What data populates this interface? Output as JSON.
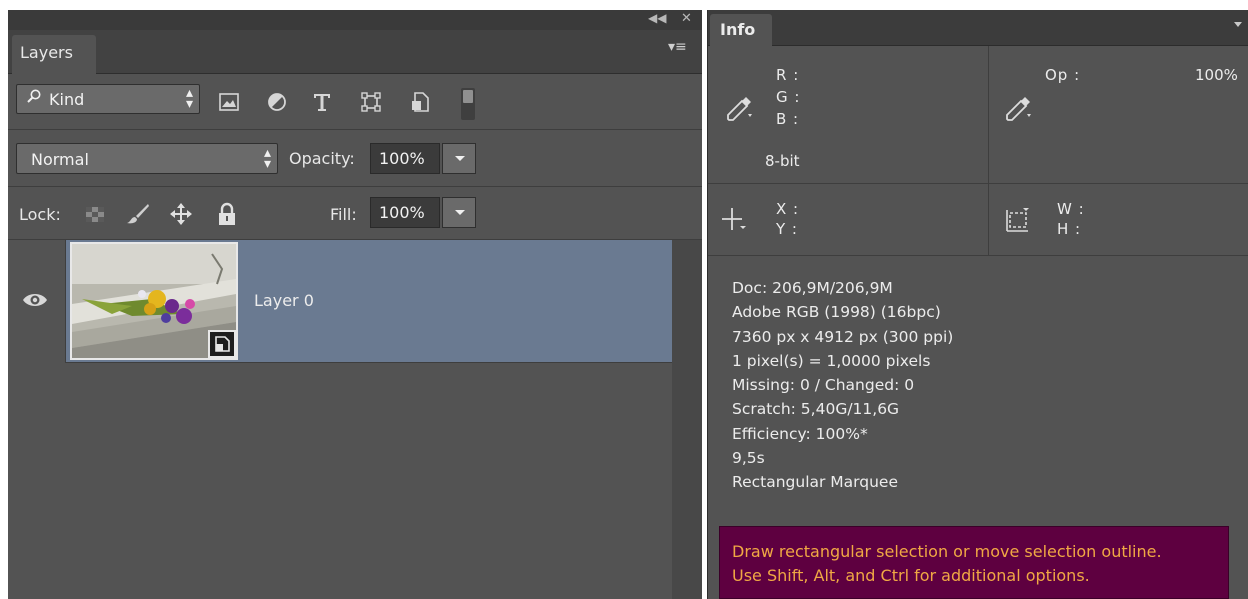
{
  "layers_panel": {
    "tab_label": "Layers",
    "filter": {
      "kind_label": "Kind"
    },
    "blend": {
      "mode": "Normal",
      "opacity_label": "Opacity:",
      "opacity_value": "100%"
    },
    "lock": {
      "label": "Lock:",
      "fill_label": "Fill:",
      "fill_value": "100%"
    },
    "layers": [
      {
        "name": "Layer 0",
        "visible": true,
        "selected": true,
        "smart_object": true
      }
    ]
  },
  "info_panel": {
    "tab_label": "Info",
    "rgb": {
      "r_label": "R :",
      "g_label": "G :",
      "b_label": "B :",
      "bit_depth": "8-bit"
    },
    "opacity": {
      "label": "Op :",
      "value": "100%"
    },
    "position": {
      "x_label": "X :",
      "y_label": "Y :"
    },
    "size": {
      "w_label": "W :",
      "h_label": "H :"
    },
    "doc_lines": [
      "Doc: 206,9M/206,9M",
      "Adobe RGB (1998) (16bpc)",
      "7360 px x 4912 px (300 ppi)",
      "1 pixel(s) = 1,0000 pixels",
      "Missing: 0 / Changed: 0",
      "Scratch: 5,40G/11,6G",
      "Efficiency: 100%*",
      "9,5s",
      "Rectangular Marquee"
    ],
    "tip_lines": [
      "Draw rectangular selection or move selection outline.",
      "Use Shift, Alt, and Ctrl for additional options."
    ]
  },
  "colors": {
    "panel_bg": "#535353",
    "selected_layer": "#6a7a91",
    "tip_bg": "#5e0040",
    "tip_text": "#f0a844"
  }
}
